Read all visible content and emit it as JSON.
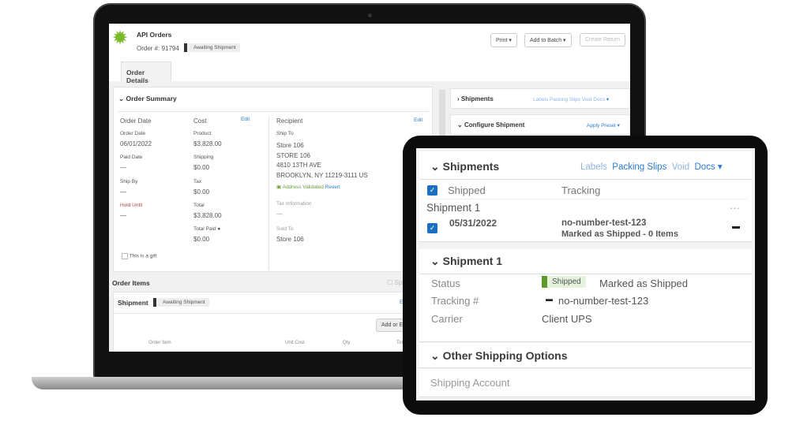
{
  "laptop": {
    "app_title": "API Orders",
    "order_number": "Order #: 91794",
    "status_badge": "Awaiting Shipment",
    "buttons": {
      "print": "Print",
      "add_to_batch": "Add to Batch",
      "create_return": "Create Return"
    },
    "tab": "Order Details",
    "order_summary": {
      "title": "Order Summary",
      "order_date_heading": "Order Date",
      "cost_heading": "Cost",
      "edit": "Edit",
      "order_date_label": "Order Date",
      "order_date": "06/01/2022",
      "paid_date_label": "Paid Date",
      "paid_date": "—",
      "ship_by_label": "Ship By",
      "ship_by": "—",
      "hold_until_label": "Hold Until",
      "hold_until": "—",
      "product_label": "Product",
      "product": "$3,828.00",
      "shipping_label": "Shipping",
      "shipping": "$0.00",
      "tax_label": "Tax",
      "tax": "$0.00",
      "total_label": "Total",
      "total": "$3,828.00",
      "total_paid_label": "Total Paid",
      "total_paid": "$0.00",
      "gift_label": "This is a gift",
      "recipient_heading": "Recipient",
      "recipient_edit": "Edit",
      "ship_to_label": "Ship To",
      "address": [
        "Store 106",
        "STORE 106",
        "4810 13TH AVE",
        "BROOKLYN, NY 11219-3111 US"
      ],
      "address_validated": "Address Validated",
      "revert": "Revert",
      "tax_info_label": "Tax Information",
      "tax_info": "—",
      "sold_to_label": "Sold To",
      "sold_to": "Store 106"
    },
    "order_items": {
      "title": "Order Items",
      "split": "Split",
      "shipment_label": "Shipment",
      "shipment_badge": "Awaiting Shipment",
      "edit": "Edit",
      "add_or_edit": "Add or Edit",
      "columns": [
        "Order Item",
        "Unit Cost",
        "Qty",
        "Total"
      ]
    },
    "right": {
      "shipments": "Shipments",
      "labels": "Labels",
      "packing_slips": "Packing Slips",
      "void": "Void",
      "docs": "Docs",
      "configure": "Configure Shipment",
      "apply_preset": "Apply Preset"
    }
  },
  "tablet": {
    "shipments_title": "Shipments",
    "labels": "Labels",
    "packing_slips": "Packing Slips",
    "void": "Void",
    "docs": "Docs",
    "col_shipped": "Shipped",
    "col_tracking": "Tracking",
    "shipment_link": "Shipment 1",
    "more": "···",
    "row_date": "05/31/2022",
    "row_tracking": "no-number-test-123",
    "row_status": "Marked as Shipped - 0 Items",
    "shipment_title": "Shipment 1",
    "status_label": "Status",
    "status_badge": "Shipped",
    "status_text": "Marked as Shipped",
    "tracking_label": "Tracking #",
    "tracking": "no-number-test-123",
    "carrier_label": "Carrier",
    "carrier": "Client UPS",
    "other_title": "Other Shipping Options",
    "shipping_account": "Shipping Account"
  },
  "colors": {
    "accent": "#2a7bd0",
    "brand_green": "#7ab929",
    "shipped_green": "#5a9a2a",
    "checkbox": "#1b6fc2"
  }
}
